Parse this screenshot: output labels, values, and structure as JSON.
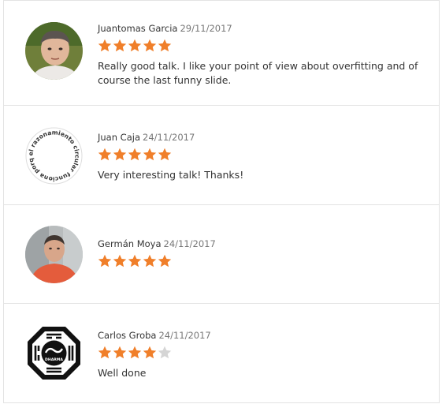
{
  "colors": {
    "star_filled": "#f07f2a",
    "star_empty": "#d5d5d5",
    "border": "#e3e3e3"
  },
  "reviews": [
    {
      "author": "Juantomas Garcia",
      "date": "29/11/2017",
      "rating": 5,
      "max_rating": 5,
      "comment": "Really good talk. I like your point of view about overfitting and of course the last funny slide.",
      "avatar": "photo-man-grey-hair-avatar"
    },
    {
      "author": "Juan Caja",
      "date": "24/11/2017",
      "rating": 5,
      "max_rating": 5,
      "comment": "Very interesting talk! Thanks!",
      "avatar": "circular-text-avatar",
      "avatar_text": "el razonamiento circular funciona porque"
    },
    {
      "author": "Germán Moya",
      "date": "24/11/2017",
      "rating": 5,
      "max_rating": 5,
      "comment": "",
      "avatar": "photo-man-red-shirt-avatar"
    },
    {
      "author": "Carlos Groba",
      "date": "24/11/2017",
      "rating": 4,
      "max_rating": 5,
      "comment": "Well done",
      "avatar": "dharma-logo-avatar",
      "avatar_text": "DHARMA"
    }
  ]
}
